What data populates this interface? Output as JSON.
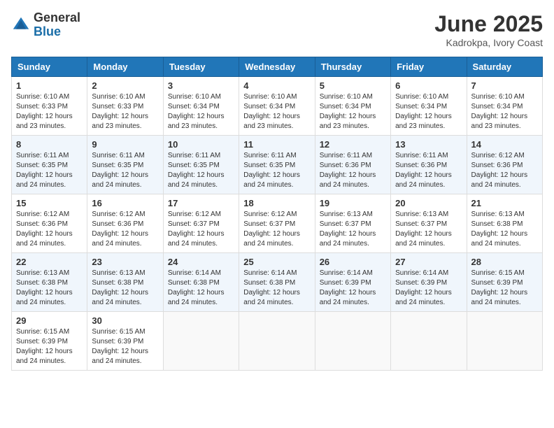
{
  "logo": {
    "general": "General",
    "blue": "Blue"
  },
  "header": {
    "month_year": "June 2025",
    "location": "Kadrokpa, Ivory Coast"
  },
  "days_of_week": [
    "Sunday",
    "Monday",
    "Tuesday",
    "Wednesday",
    "Thursday",
    "Friday",
    "Saturday"
  ],
  "weeks": [
    [
      {
        "day": "1",
        "sunrise": "6:10 AM",
        "sunset": "6:33 PM",
        "daylight": "12 hours and 23 minutes."
      },
      {
        "day": "2",
        "sunrise": "6:10 AM",
        "sunset": "6:33 PM",
        "daylight": "12 hours and 23 minutes."
      },
      {
        "day": "3",
        "sunrise": "6:10 AM",
        "sunset": "6:34 PM",
        "daylight": "12 hours and 23 minutes."
      },
      {
        "day": "4",
        "sunrise": "6:10 AM",
        "sunset": "6:34 PM",
        "daylight": "12 hours and 23 minutes."
      },
      {
        "day": "5",
        "sunrise": "6:10 AM",
        "sunset": "6:34 PM",
        "daylight": "12 hours and 23 minutes."
      },
      {
        "day": "6",
        "sunrise": "6:10 AM",
        "sunset": "6:34 PM",
        "daylight": "12 hours and 23 minutes."
      },
      {
        "day": "7",
        "sunrise": "6:10 AM",
        "sunset": "6:34 PM",
        "daylight": "12 hours and 23 minutes."
      }
    ],
    [
      {
        "day": "8",
        "sunrise": "6:11 AM",
        "sunset": "6:35 PM",
        "daylight": "12 hours and 24 minutes."
      },
      {
        "day": "9",
        "sunrise": "6:11 AM",
        "sunset": "6:35 PM",
        "daylight": "12 hours and 24 minutes."
      },
      {
        "day": "10",
        "sunrise": "6:11 AM",
        "sunset": "6:35 PM",
        "daylight": "12 hours and 24 minutes."
      },
      {
        "day": "11",
        "sunrise": "6:11 AM",
        "sunset": "6:35 PM",
        "daylight": "12 hours and 24 minutes."
      },
      {
        "day": "12",
        "sunrise": "6:11 AM",
        "sunset": "6:36 PM",
        "daylight": "12 hours and 24 minutes."
      },
      {
        "day": "13",
        "sunrise": "6:11 AM",
        "sunset": "6:36 PM",
        "daylight": "12 hours and 24 minutes."
      },
      {
        "day": "14",
        "sunrise": "6:12 AM",
        "sunset": "6:36 PM",
        "daylight": "12 hours and 24 minutes."
      }
    ],
    [
      {
        "day": "15",
        "sunrise": "6:12 AM",
        "sunset": "6:36 PM",
        "daylight": "12 hours and 24 minutes."
      },
      {
        "day": "16",
        "sunrise": "6:12 AM",
        "sunset": "6:36 PM",
        "daylight": "12 hours and 24 minutes."
      },
      {
        "day": "17",
        "sunrise": "6:12 AM",
        "sunset": "6:37 PM",
        "daylight": "12 hours and 24 minutes."
      },
      {
        "day": "18",
        "sunrise": "6:12 AM",
        "sunset": "6:37 PM",
        "daylight": "12 hours and 24 minutes."
      },
      {
        "day": "19",
        "sunrise": "6:13 AM",
        "sunset": "6:37 PM",
        "daylight": "12 hours and 24 minutes."
      },
      {
        "day": "20",
        "sunrise": "6:13 AM",
        "sunset": "6:37 PM",
        "daylight": "12 hours and 24 minutes."
      },
      {
        "day": "21",
        "sunrise": "6:13 AM",
        "sunset": "6:38 PM",
        "daylight": "12 hours and 24 minutes."
      }
    ],
    [
      {
        "day": "22",
        "sunrise": "6:13 AM",
        "sunset": "6:38 PM",
        "daylight": "12 hours and 24 minutes."
      },
      {
        "day": "23",
        "sunrise": "6:13 AM",
        "sunset": "6:38 PM",
        "daylight": "12 hours and 24 minutes."
      },
      {
        "day": "24",
        "sunrise": "6:14 AM",
        "sunset": "6:38 PM",
        "daylight": "12 hours and 24 minutes."
      },
      {
        "day": "25",
        "sunrise": "6:14 AM",
        "sunset": "6:38 PM",
        "daylight": "12 hours and 24 minutes."
      },
      {
        "day": "26",
        "sunrise": "6:14 AM",
        "sunset": "6:39 PM",
        "daylight": "12 hours and 24 minutes."
      },
      {
        "day": "27",
        "sunrise": "6:14 AM",
        "sunset": "6:39 PM",
        "daylight": "12 hours and 24 minutes."
      },
      {
        "day": "28",
        "sunrise": "6:15 AM",
        "sunset": "6:39 PM",
        "daylight": "12 hours and 24 minutes."
      }
    ],
    [
      {
        "day": "29",
        "sunrise": "6:15 AM",
        "sunset": "6:39 PM",
        "daylight": "12 hours and 24 minutes."
      },
      {
        "day": "30",
        "sunrise": "6:15 AM",
        "sunset": "6:39 PM",
        "daylight": "12 hours and 24 minutes."
      },
      null,
      null,
      null,
      null,
      null
    ]
  ]
}
